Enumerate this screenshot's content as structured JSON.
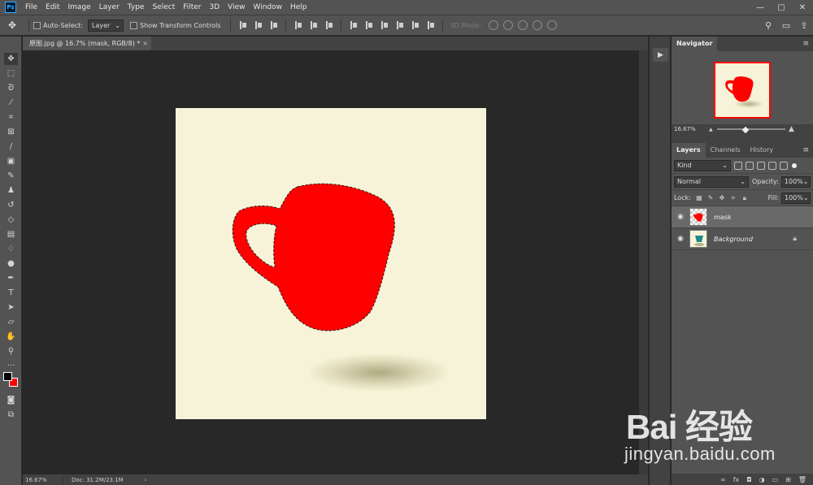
{
  "menubar": {
    "logo": "Ps",
    "items": [
      "File",
      "Edit",
      "Image",
      "Layer",
      "Type",
      "Select",
      "Filter",
      "3D",
      "View",
      "Window",
      "Help"
    ],
    "window_controls": [
      "—",
      "▢",
      "✕"
    ]
  },
  "options": {
    "move_tool_icon": "move-icon",
    "auto_select_label": "Auto-Select:",
    "auto_select_value": "Layer",
    "show_transform_label": "Show Transform Controls",
    "mode_3d_label": "3D Mode:",
    "search_icon": "search-icon",
    "workspace_icon": "workspace-icon"
  },
  "document": {
    "tab_title": "原图.jpg @ 16.7% (mask, RGB/8) *",
    "close_label": "×",
    "canvas_color": "#f6f3d8",
    "mug_color": "#ff0000"
  },
  "status": {
    "zoom": "16.67%",
    "doc_size": "Doc: 31.2M/23.1M",
    "arrow": "›"
  },
  "toolbar": {
    "tools": [
      "move-icon",
      "marquee-icon",
      "lasso-icon",
      "magic-wand-icon",
      "crop-icon",
      "frame-icon",
      "eyedropper-icon",
      "healing-icon",
      "brush-icon",
      "stamp-icon",
      "history-brush-icon",
      "eraser-icon",
      "gradient-icon",
      "blur-icon",
      "dodge-icon",
      "pen-icon",
      "type-icon",
      "path-select-icon",
      "shape-icon",
      "hand-icon",
      "zoom-icon",
      "more-icon"
    ],
    "foreground_color": "#000000",
    "background_color": "#ff0000"
  },
  "navigator": {
    "title": "Navigator",
    "zoom": "16.67%"
  },
  "layers_panel": {
    "tabs": [
      "Layers",
      "Channels",
      "History"
    ],
    "filter_kind": "Kind",
    "blend_mode": "Normal",
    "opacity_label": "Opacity:",
    "opacity_value": "100%",
    "lock_label": "Lock:",
    "fill_label": "Fill:",
    "fill_value": "100%",
    "layers": [
      {
        "name": "mask",
        "selected": true
      },
      {
        "name": "Background",
        "locked": true
      }
    ],
    "footer_icons": [
      "link-icon",
      "fx-icon",
      "mask-icon",
      "adjustment-icon",
      "folder-icon",
      "new-layer-icon",
      "trash-icon"
    ]
  },
  "watermark": {
    "logo": "Bai 经验",
    "url": "jingyan.baidu.com"
  }
}
